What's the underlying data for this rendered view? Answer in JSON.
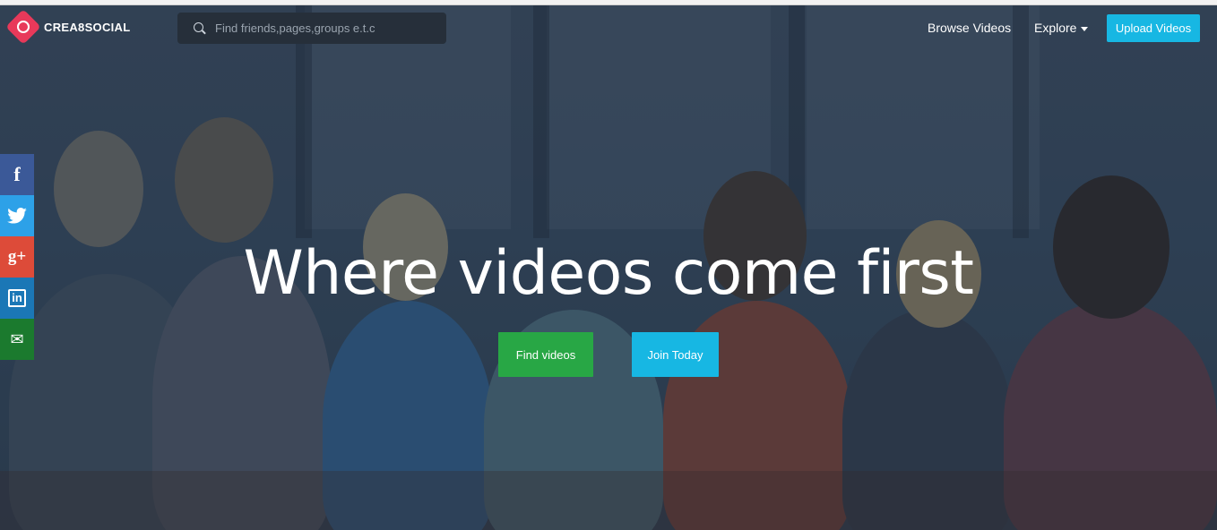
{
  "brand": {
    "name": "CREA8SOCIAL",
    "accent": "#e8395a"
  },
  "search": {
    "placeholder": "Find friends,pages,groups e.t.c",
    "value": ""
  },
  "nav": {
    "browse_videos": "Browse Videos",
    "explore": "Explore",
    "upload_videos": "Upload Videos",
    "upload_color": "#17b7e3"
  },
  "social": [
    {
      "name": "facebook",
      "glyph": "f",
      "color": "#3b5998"
    },
    {
      "name": "twitter",
      "glyph": "🐦",
      "color": "#2da1e8"
    },
    {
      "name": "google-plus",
      "glyph": "g+",
      "color": "#dd4b39"
    },
    {
      "name": "linkedin",
      "glyph": "in",
      "color": "#1b77b6"
    },
    {
      "name": "email",
      "glyph": "✉",
      "color": "#1b7a2e"
    }
  ],
  "hero": {
    "headline": "Where videos come first",
    "find_videos": "Find videos",
    "join_today": "Join Today"
  }
}
